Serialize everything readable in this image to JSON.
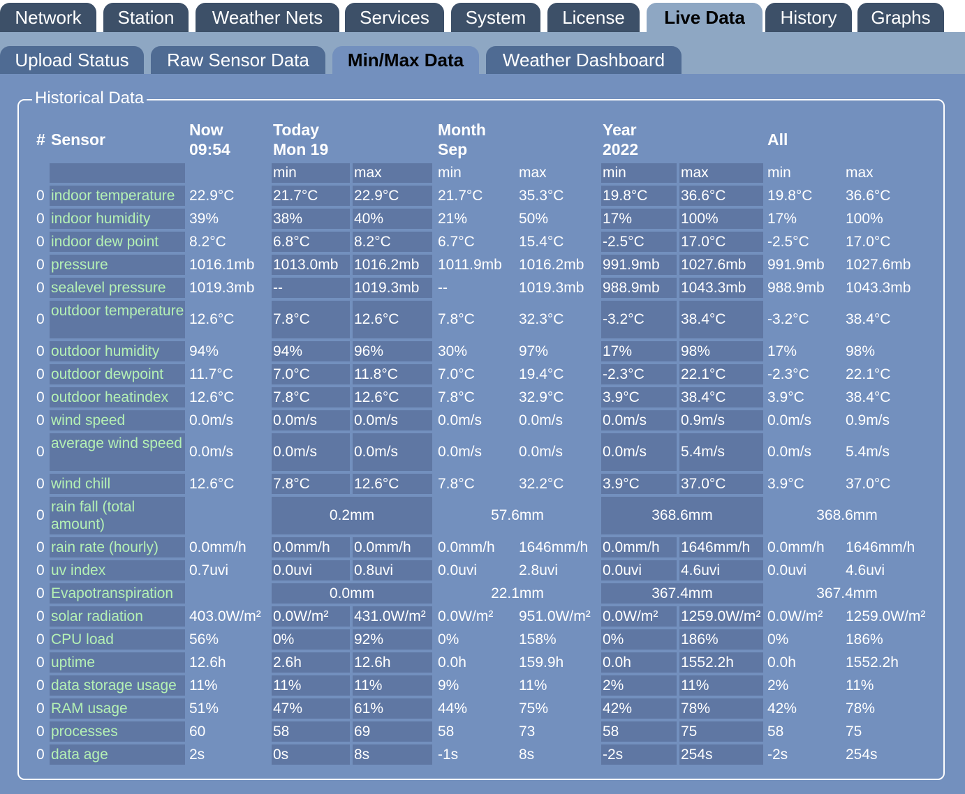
{
  "main_tabs": [
    "Network",
    "Station",
    "Weather Nets",
    "Services",
    "System",
    "License",
    "Live Data",
    "History",
    "Graphs"
  ],
  "sub_tabs": [
    "Upload Status",
    "Raw Sensor Data",
    "Min/Max Data",
    "Weather Dashboard"
  ],
  "active_main_tab": "Live Data",
  "active_sub_tab": "Min/Max Data",
  "panel_title": "Historical Data",
  "table": {
    "header_hash": "#",
    "header_sensor": "Sensor",
    "header_now": "Now\n09:54",
    "header_today": "Today\nMon 19",
    "header_month": "Month\nSep",
    "header_year": "Year\n2022",
    "header_all": "All",
    "min_label": "min",
    "max_label": "max",
    "rows": [
      {
        "num": "0",
        "label": "indoor temperature",
        "now": "22.9°C",
        "tmin": "21.7°C",
        "tmax": "22.9°C",
        "mmin": "21.7°C",
        "mmax": "35.3°C",
        "ymin": "19.8°C",
        "ymax": "36.6°C",
        "amin": "19.8°C",
        "amax": "36.6°C"
      },
      {
        "num": "0",
        "label": "indoor humidity",
        "now": "39%",
        "tmin": "38%",
        "tmax": "40%",
        "mmin": "21%",
        "mmax": "50%",
        "ymin": "17%",
        "ymax": "100%",
        "amin": "17%",
        "amax": "100%"
      },
      {
        "num": "0",
        "label": "indoor dew point",
        "now": "8.2°C",
        "tmin": "6.8°C",
        "tmax": "8.2°C",
        "mmin": "6.7°C",
        "mmax": "15.4°C",
        "ymin": "-2.5°C",
        "ymax": "17.0°C",
        "amin": "-2.5°C",
        "amax": "17.0°C"
      },
      {
        "num": "0",
        "label": "pressure",
        "now": "1016.1mb",
        "tmin": "1013.0mb",
        "tmax": "1016.2mb",
        "mmin": "1011.9mb",
        "mmax": "1016.2mb",
        "ymin": "991.9mb",
        "ymax": "1027.6mb",
        "amin": "991.9mb",
        "amax": "1027.6mb"
      },
      {
        "num": "0",
        "label": "sealevel pressure",
        "now": "1019.3mb",
        "tmin": "--",
        "tmax": "1019.3mb",
        "mmin": "--",
        "mmax": "1019.3mb",
        "ymin": "988.9mb",
        "ymax": "1043.3mb",
        "amin": "988.9mb",
        "amax": "1043.3mb"
      },
      {
        "num": "0",
        "label": "outdoor temperature",
        "now": "12.6°C",
        "tmin": "7.8°C",
        "tmax": "12.6°C",
        "mmin": "7.8°C",
        "mmax": "32.3°C",
        "ymin": "-3.2°C",
        "ymax": "38.4°C",
        "amin": "-3.2°C",
        "amax": "38.4°C"
      },
      {
        "num": "0",
        "label": "outdoor humidity",
        "now": "94%",
        "tmin": "94%",
        "tmax": "96%",
        "mmin": "30%",
        "mmax": "97%",
        "ymin": "17%",
        "ymax": "98%",
        "amin": "17%",
        "amax": "98%"
      },
      {
        "num": "0",
        "label": "outdoor dewpoint",
        "now": "11.7°C",
        "tmin": "7.0°C",
        "tmax": "11.8°C",
        "mmin": "7.0°C",
        "mmax": "19.4°C",
        "ymin": "-2.3°C",
        "ymax": "22.1°C",
        "amin": "-2.3°C",
        "amax": "22.1°C"
      },
      {
        "num": "0",
        "label": "outdoor heatindex",
        "now": "12.6°C",
        "tmin": "7.8°C",
        "tmax": "12.6°C",
        "mmin": "7.8°C",
        "mmax": "32.9°C",
        "ymin": "3.9°C",
        "ymax": "38.4°C",
        "amin": "3.9°C",
        "amax": "38.4°C"
      },
      {
        "num": "0",
        "label": "wind speed",
        "now": "0.0m/s",
        "tmin": "0.0m/s",
        "tmax": "0.0m/s",
        "mmin": "0.0m/s",
        "mmax": "0.0m/s",
        "ymin": "0.0m/s",
        "ymax": "0.9m/s",
        "amin": "0.0m/s",
        "amax": "0.9m/s"
      },
      {
        "num": "0",
        "label": "average wind speed",
        "now": "0.0m/s",
        "tmin": "0.0m/s",
        "tmax": "0.0m/s",
        "mmin": "0.0m/s",
        "mmax": "0.0m/s",
        "ymin": "0.0m/s",
        "ymax": "5.4m/s",
        "amin": "0.0m/s",
        "amax": "5.4m/s"
      },
      {
        "num": "0",
        "label": "wind chill",
        "now": "12.6°C",
        "tmin": "7.8°C",
        "tmax": "12.6°C",
        "mmin": "7.8°C",
        "mmax": "32.2°C",
        "ymin": "3.9°C",
        "ymax": "37.0°C",
        "amin": "3.9°C",
        "amax": "37.0°C"
      },
      {
        "num": "0",
        "label": "rain fall (total amount)",
        "now": "",
        "today": "0.2mm",
        "month": "57.6mm",
        "year": "368.6mm",
        "all": "368.6mm"
      },
      {
        "num": "0",
        "label": "rain rate (hourly)",
        "now": "0.0mm/h",
        "tmin": "0.0mm/h",
        "tmax": "0.0mm/h",
        "mmin": "0.0mm/h",
        "mmax": "1646mm/h",
        "ymin": "0.0mm/h",
        "ymax": "1646mm/h",
        "amin": "0.0mm/h",
        "amax": "1646mm/h"
      },
      {
        "num": "0",
        "label": "uv index",
        "now": "0.7uvi",
        "tmin": "0.0uvi",
        "tmax": "0.8uvi",
        "mmin": "0.0uvi",
        "mmax": "2.8uvi",
        "ymin": "0.0uvi",
        "ymax": "4.6uvi",
        "amin": "0.0uvi",
        "amax": "4.6uvi"
      },
      {
        "num": "0",
        "label": "Evapotranspiration",
        "now": "",
        "today": "0.0mm",
        "month": "22.1mm",
        "year": "367.4mm",
        "all": "367.4mm"
      },
      {
        "num": "0",
        "label": "solar radiation",
        "now": "403.0W/m²",
        "tmin": "0.0W/m²",
        "tmax": "431.0W/m²",
        "mmin": "0.0W/m²",
        "mmax": "951.0W/m²",
        "ymin": "0.0W/m²",
        "ymax": "1259.0W/m²",
        "amin": "0.0W/m²",
        "amax": "1259.0W/m²"
      },
      {
        "num": "0",
        "label": "CPU load",
        "now": "56%",
        "tmin": "0%",
        "tmax": "92%",
        "mmin": "0%",
        "mmax": "158%",
        "ymin": "0%",
        "ymax": "186%",
        "amin": "0%",
        "amax": "186%"
      },
      {
        "num": "0",
        "label": "uptime",
        "now": "12.6h",
        "tmin": "2.6h",
        "tmax": "12.6h",
        "mmin": "0.0h",
        "mmax": "159.9h",
        "ymin": "0.0h",
        "ymax": "1552.2h",
        "amin": "0.0h",
        "amax": "1552.2h"
      },
      {
        "num": "0",
        "label": "data storage usage",
        "now": "11%",
        "tmin": "11%",
        "tmax": "11%",
        "mmin": "9%",
        "mmax": "11%",
        "ymin": "2%",
        "ymax": "11%",
        "amin": "2%",
        "amax": "11%"
      },
      {
        "num": "0",
        "label": "RAM usage",
        "now": "51%",
        "tmin": "47%",
        "tmax": "61%",
        "mmin": "44%",
        "mmax": "75%",
        "ymin": "42%",
        "ymax": "78%",
        "amin": "42%",
        "amax": "78%"
      },
      {
        "num": "0",
        "label": "processes",
        "now": "60",
        "tmin": "58",
        "tmax": "69",
        "mmin": "58",
        "mmax": "73",
        "ymin": "58",
        "ymax": "75",
        "amin": "58",
        "amax": "75"
      },
      {
        "num": "0",
        "label": "data age",
        "now": "2s",
        "tmin": "0s",
        "tmax": "8s",
        "mmin": "-1s",
        "mmax": "8s",
        "ymin": "-2s",
        "ymax": "254s",
        "amin": "-2s",
        "amax": "254s"
      }
    ]
  },
  "colors": {
    "tab_dark": "#3d5068",
    "tab_sub": "#4f6b93",
    "content_bg": "#7390be",
    "cell_shade": "#5f77a3",
    "sensor_label": "#b4f0b4"
  }
}
